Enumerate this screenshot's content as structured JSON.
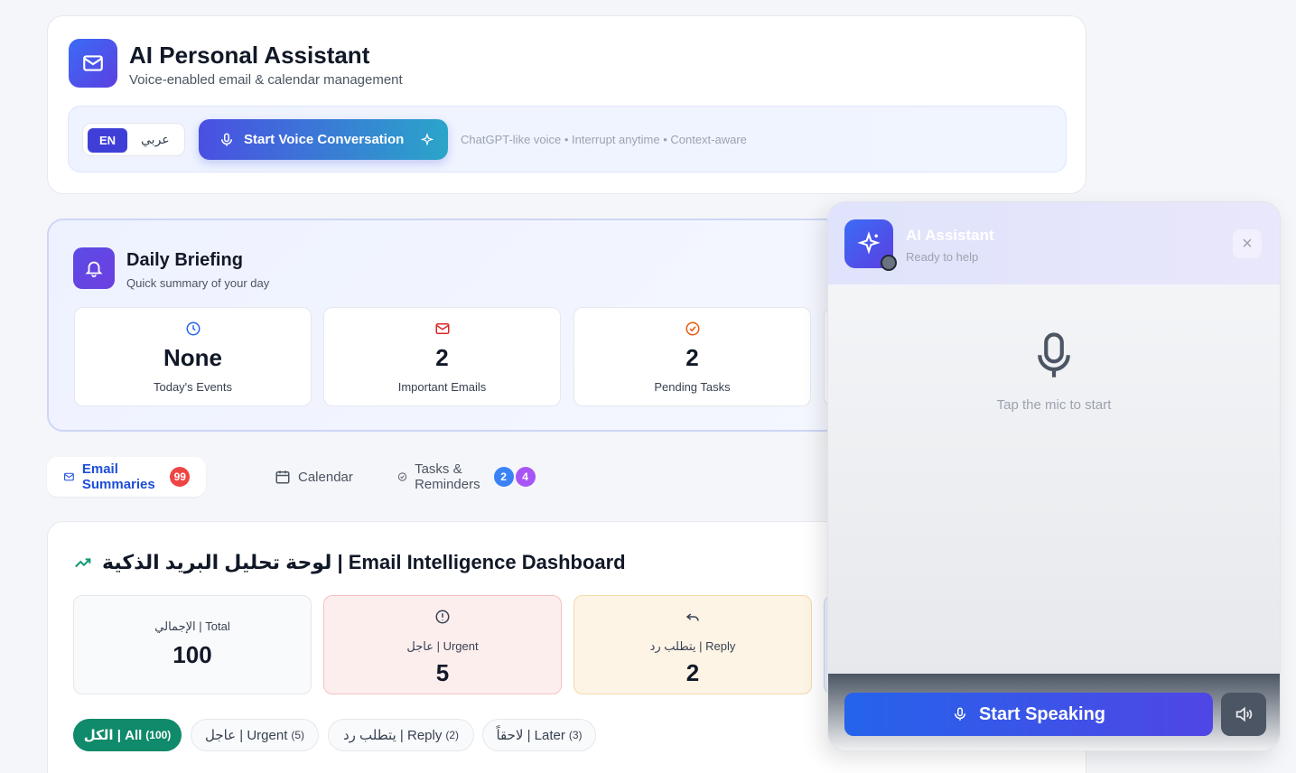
{
  "header": {
    "title": "AI Personal Assistant",
    "subtitle": "Voice-enabled email & calendar management",
    "lang_en": "EN",
    "lang_ar": "عربي",
    "voice_button": "Start Voice Conversation",
    "hint": "ChatGPT-like voice • Interrupt anytime • Context-aware"
  },
  "briefing": {
    "title": "Daily Briefing",
    "subtitle": "Quick summary of your day",
    "stats": [
      {
        "value": "None",
        "label": "Today's Events",
        "icon": "clock-icon",
        "color": "#2563eb"
      },
      {
        "value": "2",
        "label": "Important Emails",
        "icon": "mail-icon",
        "color": "#dc2626"
      },
      {
        "value": "2",
        "label": "Pending Tasks",
        "icon": "check-circle-icon",
        "color": "#ea580c"
      }
    ]
  },
  "tabs": [
    {
      "label": "Email Summaries",
      "badge": "99",
      "badge_color": "#ef4444",
      "icon": "mail-icon"
    },
    {
      "label": "Calendar",
      "icon": "calendar-icon"
    },
    {
      "label": "Tasks & Reminders",
      "badge": "2",
      "badge2": "4",
      "badge_color": "#3b82f6",
      "badge2_color": "#a855f7",
      "icon": "check-circle-icon"
    }
  ],
  "dashboard": {
    "title": "لوحة تحليل البريد الذكية | Email Intelligence Dashboard",
    "metrics": [
      {
        "label": "الإجمالي | Total",
        "value": "100"
      },
      {
        "label": "عاجل | Urgent",
        "value": "5",
        "icon": "alert-circle-icon"
      },
      {
        "label": "يتطلب رد | Reply",
        "value": "2",
        "icon": "reply-icon"
      }
    ],
    "filters": [
      {
        "label": "الكل | All",
        "count": "(100)"
      },
      {
        "label": "عاجل | Urgent",
        "count": "(5)"
      },
      {
        "label": "يتطلب رد | Reply",
        "count": "(2)"
      },
      {
        "label": "لاحقاً | Later",
        "count": "(3)"
      }
    ]
  },
  "assistant": {
    "title": "AI Assistant",
    "status": "Ready to help",
    "close": "×",
    "tap_hint": "Tap the mic to start",
    "speak_button": "Start Speaking"
  }
}
